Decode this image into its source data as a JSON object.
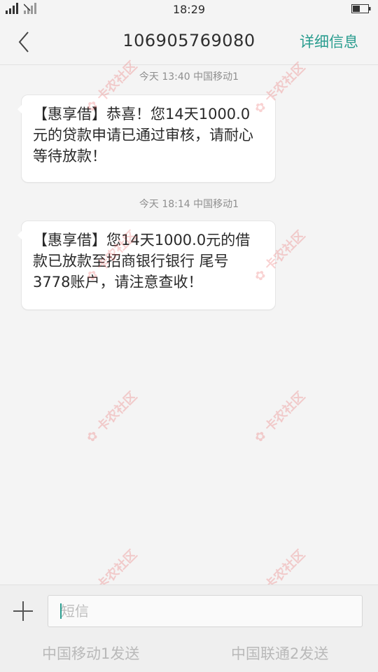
{
  "status_bar": {
    "time": "18:29",
    "signal_icons": [
      "cellular-signal-icon",
      "no-sim-signal-icon"
    ],
    "battery_icon": "battery-icon"
  },
  "header": {
    "back_icon": "chevron-left-icon",
    "contact": "106905769080",
    "details_label": "详细信息"
  },
  "messages": [
    {
      "timestamp": "今天  13:40   中国移动1",
      "text": "【惠享借】恭喜！您14天1000.0元的贷款申请已通过审核，请耐心等待放款！"
    },
    {
      "timestamp": "今天  18:14   中国移动1",
      "text": "【惠享借】您14天1000.0元的借款已放款至招商银行银行 尾号3778账户，请注意查收！"
    }
  ],
  "watermark_text": "卡农社区",
  "composer": {
    "add_icon": "plus-icon",
    "input_placeholder": "短信",
    "send_sim1": "中国移动1发送",
    "send_sim2": "中国联通2发送"
  },
  "colors": {
    "accent": "#2a9d8f",
    "watermark": "#e85c5c"
  }
}
